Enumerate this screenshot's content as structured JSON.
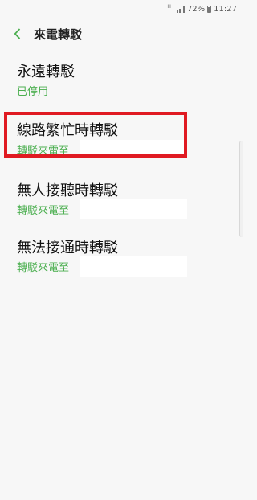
{
  "status_bar": {
    "network": "H+",
    "battery_percent": "72%",
    "time": "11:27"
  },
  "header": {
    "back_icon": "chevron-left-icon",
    "title": "來電轉駁"
  },
  "items": [
    {
      "label": "永遠轉駁",
      "sub": "已停用"
    },
    {
      "label": "線路繁忙時轉駁",
      "sub": "轉駁來電至"
    },
    {
      "label": "無人接聽時轉駁",
      "sub": "轉駁來電至"
    },
    {
      "label": "無法接通時轉駁",
      "sub": "轉駁來電至"
    }
  ],
  "colors": {
    "accent_green": "#4caf50",
    "highlight_red": "#e01a22",
    "background": "#f7f7f7"
  }
}
